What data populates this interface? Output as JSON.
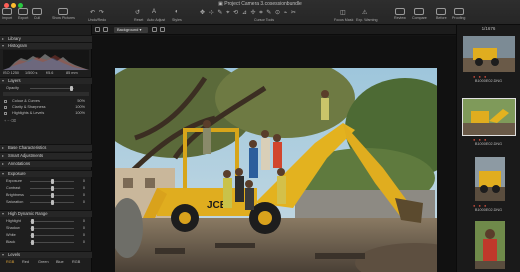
{
  "window": {
    "title": "Project Camera 3.cosessionbundle"
  },
  "toolbar": {
    "left": [
      {
        "label": "Import"
      },
      {
        "label": "Export"
      },
      {
        "label": "Cull"
      },
      {
        "label": "Show Pictures"
      }
    ],
    "undo_redo": "Undo/Redo",
    "reset": "Reset",
    "auto_adjust": "Auto Adjust",
    "styles": "Styles",
    "cursor_tools": "Cursor Tools",
    "focus_mask": "Focus Mask",
    "exp_warning": "Exp. Warning",
    "right": [
      {
        "label": "Review"
      },
      {
        "label": "Compare"
      },
      {
        "label": "Before"
      },
      {
        "label": "Proofing"
      }
    ]
  },
  "viewer_bar": {
    "background_select": "Background"
  },
  "left_panel": {
    "sections": {
      "library": "Library",
      "histogram": "Histogram",
      "layers": "Layers",
      "base_characteristics": "Base Characteristics",
      "smart_adjustments": "Smart Adjustments",
      "annotations": "Annotations",
      "exposure": "Exposure",
      "hdr": "High Dynamic Range",
      "levels": "Levels"
    },
    "histogram_info": {
      "iso": "ISO 1250",
      "shutter": "1/500 s",
      "aperture": "f/5.6",
      "focal": "85 mm"
    },
    "layers": {
      "opacity_label": "Opacity",
      "items": [
        {
          "name": "Colour & Curves",
          "value": "50%"
        },
        {
          "name": "Clarity & Sharpness",
          "value": "100%"
        },
        {
          "name": "Highlights & Levels",
          "value": "100%"
        }
      ]
    },
    "exposure": [
      {
        "label": "Exposure",
        "value": "0",
        "pos": 0.5
      },
      {
        "label": "Contrast",
        "value": "0",
        "pos": 0.5
      },
      {
        "label": "Brightness",
        "value": "0",
        "pos": 0.5
      },
      {
        "label": "Saturation",
        "value": "0",
        "pos": 0.5
      }
    ],
    "hdr": [
      {
        "label": "Highlight",
        "value": "0",
        "pos": 0.05
      },
      {
        "label": "Shadow",
        "value": "0",
        "pos": 0.05
      },
      {
        "label": "White",
        "value": "0",
        "pos": 0.05
      },
      {
        "label": "Black",
        "value": "0",
        "pos": 0.05
      }
    ],
    "levels_channels": [
      "RGB",
      "Red",
      "Green",
      "Blue",
      "RGB"
    ]
  },
  "browser": {
    "counter": "1/1676",
    "thumbs": [
      {
        "name": "B1000E02.DNG"
      },
      {
        "name": "B1000E02.DNG"
      },
      {
        "name": "B1000E02.DNG"
      },
      {
        "name": "B1000E02.DNG"
      }
    ]
  }
}
